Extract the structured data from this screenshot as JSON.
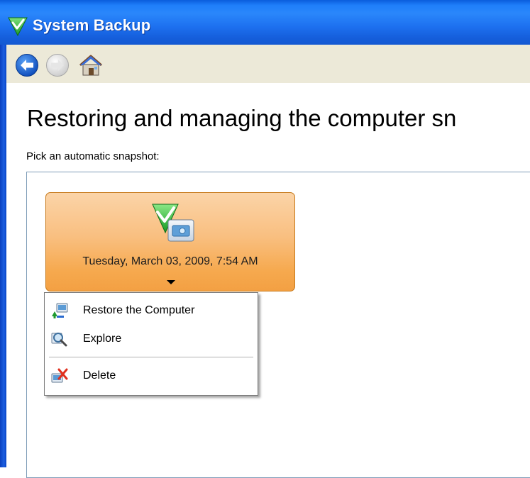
{
  "window": {
    "title": "System Backup",
    "title_icon": "green-checkmark-icon"
  },
  "toolbar": {
    "back_icon": "back-arrow-icon",
    "forward_icon": "forward-arrow-icon",
    "home_icon": "home-icon"
  },
  "main": {
    "heading": "Restoring and managing the computer sn",
    "subheading": "Pick an automatic snapshot:"
  },
  "snapshot": {
    "date_label": "Tuesday, March 03, 2009, 7:54 AM",
    "icon": "snapshot-icon",
    "colors": {
      "gradient_top": "#fbd4a8",
      "gradient_bottom": "#f3a043",
      "border": "#c77a1c"
    }
  },
  "context_menu": {
    "items": [
      {
        "label": "Restore the Computer",
        "icon": "restore-computer-icon"
      },
      {
        "label": "Explore",
        "icon": "explore-magnifier-icon"
      },
      {
        "label": "Delete",
        "icon": "delete-icon"
      }
    ]
  },
  "colors": {
    "titlebar": "#1f7ffa",
    "toolbar": "#ece9d8",
    "frame": "#0a3fbe"
  }
}
